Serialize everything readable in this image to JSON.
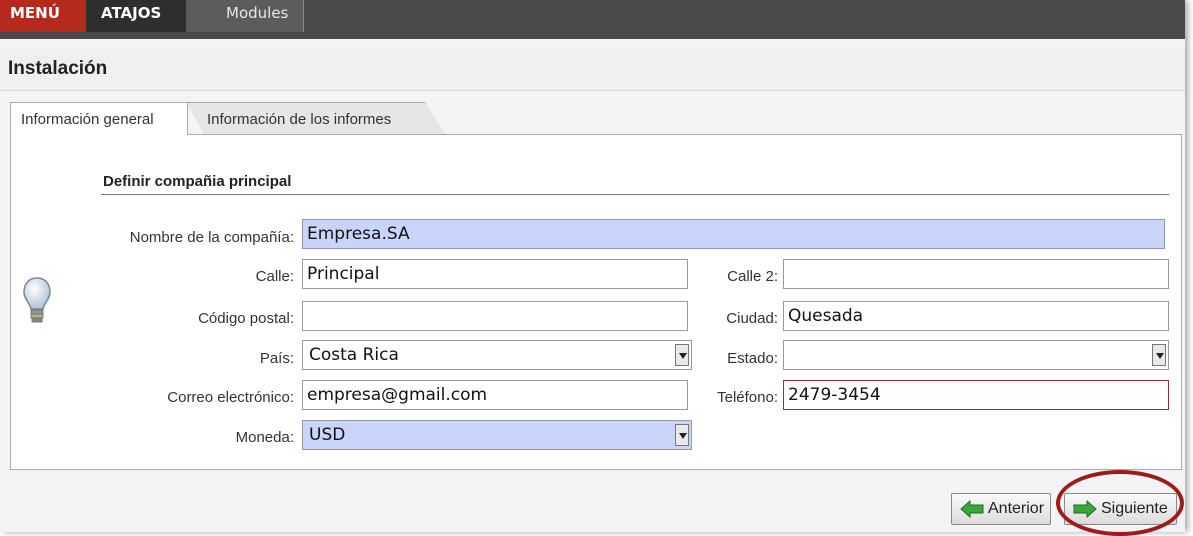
{
  "nav": {
    "menu_label": "MENÚ",
    "shortcuts_label": "ATAJOS",
    "modules_label": "Modules"
  },
  "page": {
    "title": "Instalación"
  },
  "tabs": [
    {
      "label": "Información general",
      "active": true
    },
    {
      "label": "Información de los informes",
      "active": false
    }
  ],
  "form": {
    "section_title": "Definir compañia principal",
    "company_name": {
      "label": "Nombre de la compañía:",
      "value": "Empresa.SA"
    },
    "street": {
      "label": "Calle:",
      "value": "Principal"
    },
    "street2": {
      "label": "Calle 2:",
      "value": ""
    },
    "postal_code": {
      "label": "Código postal:",
      "value": ""
    },
    "city": {
      "label": "Ciudad:",
      "value": "Quesada"
    },
    "country": {
      "label": "País:",
      "value": "Costa Rica"
    },
    "state": {
      "label": "Estado:",
      "value": ""
    },
    "email": {
      "label": "Correo electrónico:",
      "value": "empresa@gmail.com"
    },
    "phone": {
      "label": "Teléfono:",
      "value": "2479-3454"
    },
    "currency": {
      "label": "Moneda:",
      "value": "USD"
    }
  },
  "buttons": {
    "previous_label": "Anterior",
    "next_label": "Siguiente"
  },
  "icons": {
    "hint": "lightbulb-icon",
    "previous": "arrow-left-icon",
    "next": "arrow-right-icon"
  },
  "colors": {
    "menu_red": "#b52a1d",
    "required_field_blue": "#c9d4fb",
    "highlight_ring": "#9e1b1b",
    "arrow_green": "#3aa53a"
  }
}
